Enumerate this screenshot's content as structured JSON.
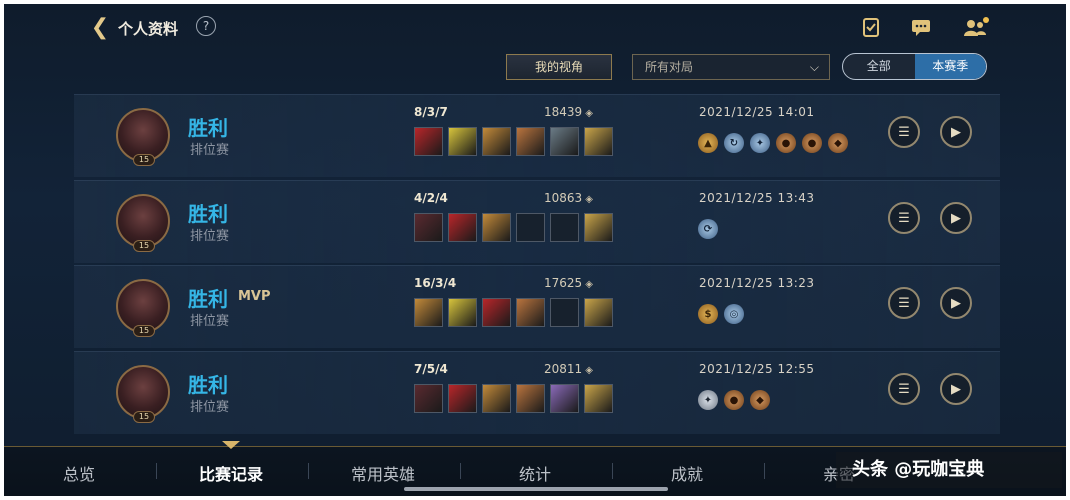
{
  "header": {
    "back_glyph": "❮",
    "title": "个人资料",
    "help_glyph": "?",
    "icons": [
      "task-icon",
      "chat-icon",
      "friends-icon"
    ]
  },
  "filters": {
    "my_view": "我的视角",
    "mode_select": "所有对局",
    "toggle_all": "全部",
    "toggle_season": "本赛季"
  },
  "matches": [
    {
      "result": "胜利",
      "mvp": "",
      "mode": "排位赛",
      "level": "15",
      "kda": "8/3/7",
      "gold": "18439",
      "time": "2021/12/25 14:01",
      "items": [
        "#b8262a",
        "#d7c43c",
        "#c28a3a",
        "#b9743e",
        "#6a7b86",
        "#c9a54a"
      ],
      "badges": [
        [
          "b-gold",
          "▲"
        ],
        [
          "b-blue",
          "↻"
        ],
        [
          "b-blue",
          "✦"
        ],
        [
          "b-bronze",
          "●"
        ],
        [
          "b-bronze",
          "●"
        ],
        [
          "b-bronze",
          "◆"
        ]
      ]
    },
    {
      "result": "胜利",
      "mvp": "",
      "mode": "排位赛",
      "level": "15",
      "kda": "4/2/4",
      "gold": "10863",
      "time": "2021/12/25 13:43",
      "items": [
        "#5a2a30",
        "#b8262a",
        "#c28a3a",
        "",
        "",
        "#c9a54a"
      ],
      "badges": [
        [
          "b-blue",
          "⟳"
        ]
      ]
    },
    {
      "result": "胜利",
      "mvp": "MVP",
      "mode": "排位赛",
      "level": "15",
      "kda": "16/3/4",
      "gold": "17625",
      "time": "2021/12/25 13:23",
      "items": [
        "#c28a3a",
        "#d7c43c",
        "#b8262a",
        "#b9743e",
        "",
        "#c9a54a"
      ],
      "badges": [
        [
          "b-gold",
          "$"
        ],
        [
          "b-blue",
          "◎"
        ]
      ]
    },
    {
      "result": "胜利",
      "mvp": "",
      "mode": "排位赛",
      "level": "15",
      "kda": "7/5/4",
      "gold": "20811",
      "time": "2021/12/25 12:55",
      "items": [
        "#5a2a30",
        "#b8262a",
        "#c28a3a",
        "#b9743e",
        "#8a6ab8",
        "#c9a54a"
      ],
      "badges": [
        [
          "b-silver",
          "✦"
        ],
        [
          "b-bronze",
          "●"
        ],
        [
          "b-bronze",
          "◆"
        ]
      ]
    }
  ],
  "nav": {
    "tabs": [
      "总览",
      "比赛记录",
      "常用英雄",
      "统计",
      "成就",
      "亲密"
    ],
    "active_index": 1
  },
  "watermark": "头条 @玩咖宝典",
  "colors": {
    "win": "#35b6e6",
    "accent_gold": "#d8b56a",
    "toggle_active": "#2d6ea7"
  }
}
